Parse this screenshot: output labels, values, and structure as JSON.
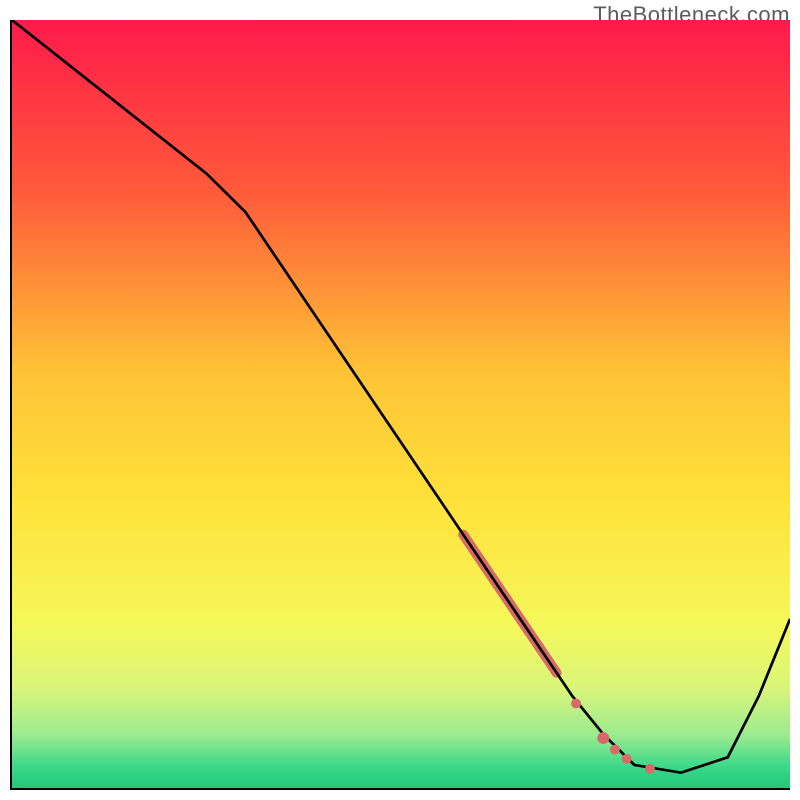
{
  "watermark": "TheBottleneck.com",
  "chart_data": {
    "type": "line",
    "title": "",
    "xlabel": "",
    "ylabel": "",
    "xlim": [
      0,
      100
    ],
    "ylim": [
      0,
      100
    ],
    "gradient_stops": [
      {
        "offset": 0,
        "color": "#ff1a4b"
      },
      {
        "offset": 0.22,
        "color": "#ff5a3a"
      },
      {
        "offset": 0.45,
        "color": "#ffc236"
      },
      {
        "offset": 0.62,
        "color": "#ffe23a"
      },
      {
        "offset": 0.78,
        "color": "#f4f85a"
      },
      {
        "offset": 0.86,
        "color": "#d8f57a"
      },
      {
        "offset": 0.92,
        "color": "#9aeb8f"
      },
      {
        "offset": 0.96,
        "color": "#3ad88a"
      },
      {
        "offset": 1.0,
        "color": "#18c06e"
      }
    ],
    "series": [
      {
        "name": "curve",
        "color": "#000000",
        "x": [
          0,
          5,
          15,
          25,
          30,
          40,
          50,
          60,
          68,
          72,
          76,
          80,
          86,
          92,
          96,
          100
        ],
        "y": [
          100,
          96,
          88,
          80,
          75,
          60,
          45,
          30,
          18,
          12,
          7,
          3,
          2,
          4,
          12,
          22
        ]
      }
    ],
    "highlight_segments": [
      {
        "name": "thick-highlight",
        "color": "#d86a6a",
        "width": 10,
        "x": [
          58,
          61,
          64,
          67,
          70
        ],
        "y": [
          33,
          28.5,
          24,
          19.5,
          15
        ]
      }
    ],
    "highlight_points": [
      {
        "x": 72.5,
        "y": 11,
        "r": 5,
        "color": "#d86a6a"
      },
      {
        "x": 76,
        "y": 6.5,
        "r": 6,
        "color": "#d86a6a"
      },
      {
        "x": 77.5,
        "y": 5,
        "r": 5,
        "color": "#d86a6a"
      },
      {
        "x": 79,
        "y": 3.8,
        "r": 5,
        "color": "#d86a6a"
      },
      {
        "x": 82,
        "y": 2.5,
        "r": 5,
        "color": "#d86a6a"
      }
    ]
  }
}
